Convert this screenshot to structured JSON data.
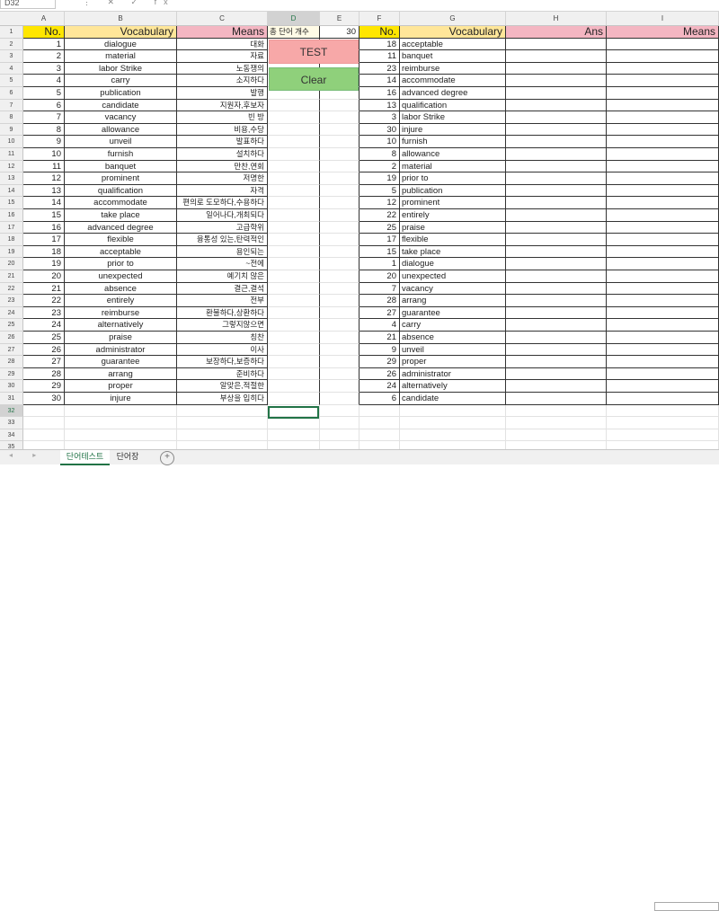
{
  "formula_bar": {
    "name_box": "D32",
    "icons": "⋮ ✕ ✓ fx"
  },
  "columns": [
    "A",
    "B",
    "C",
    "D",
    "E",
    "F",
    "G",
    "H",
    "I"
  ],
  "selected_column": "D",
  "headers": {
    "no": "No.",
    "vocab": "Vocabulary",
    "means": "Means",
    "count_label": "총 단어 개수",
    "count_value": "30",
    "no2": "No.",
    "vocab2": "Vocabulary",
    "ans": "Ans",
    "means2": "Means"
  },
  "buttons": {
    "test": "TEST",
    "clear": "Clear"
  },
  "left_table": [
    [
      "1",
      "dialogue",
      "대화"
    ],
    [
      "2",
      "material",
      "자료"
    ],
    [
      "3",
      "labor Strike",
      "노동쟁의"
    ],
    [
      "4",
      "carry",
      "소지하다"
    ],
    [
      "5",
      "publication",
      "발행"
    ],
    [
      "6",
      "candidate",
      "지원자,후보자"
    ],
    [
      "7",
      "vacancy",
      "빈 방"
    ],
    [
      "8",
      "allowance",
      "비용,수당"
    ],
    [
      "9",
      "unveil",
      "발표하다"
    ],
    [
      "10",
      "furnish",
      "설치하다"
    ],
    [
      "11",
      "banquet",
      "만찬,연회"
    ],
    [
      "12",
      "prominent",
      "저명한"
    ],
    [
      "13",
      "qualification",
      "자격"
    ],
    [
      "14",
      "accommodate",
      "편의로 도모하다,수용하다"
    ],
    [
      "15",
      "take place",
      "일어나다,개최되다"
    ],
    [
      "16",
      "advanced degree",
      "고급학위"
    ],
    [
      "17",
      "flexible",
      "융통성 있는,탄력적인"
    ],
    [
      "18",
      "acceptable",
      "용인되는"
    ],
    [
      "19",
      "prior to",
      "~전에"
    ],
    [
      "20",
      "unexpected",
      "예기치 않은"
    ],
    [
      "21",
      "absence",
      "결근,결석"
    ],
    [
      "22",
      "entirely",
      "전부"
    ],
    [
      "23",
      "reimburse",
      "환불하다,상환하다"
    ],
    [
      "24",
      "alternatively",
      "그렇지않으면"
    ],
    [
      "25",
      "praise",
      "칭찬"
    ],
    [
      "26",
      "administrator",
      "이사"
    ],
    [
      "27",
      "guarantee",
      "보장하다,보증하다"
    ],
    [
      "28",
      "arrang",
      "준비하다"
    ],
    [
      "29",
      "proper",
      "알맞은,적절한"
    ],
    [
      "30",
      "injure",
      "부상을 입히다"
    ]
  ],
  "right_table": [
    [
      "18",
      "acceptable"
    ],
    [
      "11",
      "banquet"
    ],
    [
      "23",
      "reimburse"
    ],
    [
      "14",
      "accommodate"
    ],
    [
      "16",
      "advanced degree"
    ],
    [
      "13",
      "qualification"
    ],
    [
      "3",
      "labor Strike"
    ],
    [
      "30",
      "injure"
    ],
    [
      "10",
      "furnish"
    ],
    [
      "8",
      "allowance"
    ],
    [
      "2",
      "material"
    ],
    [
      "19",
      "prior to"
    ],
    [
      "5",
      "publication"
    ],
    [
      "12",
      "prominent"
    ],
    [
      "22",
      "entirely"
    ],
    [
      "25",
      "praise"
    ],
    [
      "17",
      "flexible"
    ],
    [
      "15",
      "take place"
    ],
    [
      "1",
      "dialogue"
    ],
    [
      "20",
      "unexpected"
    ],
    [
      "7",
      "vacancy"
    ],
    [
      "28",
      "arrang"
    ],
    [
      "27",
      "guarantee"
    ],
    [
      "4",
      "carry"
    ],
    [
      "21",
      "absence"
    ],
    [
      "9",
      "unveil"
    ],
    [
      "29",
      "proper"
    ],
    [
      "26",
      "administrator"
    ],
    [
      "24",
      "alternatively"
    ],
    [
      "6",
      "candidate"
    ]
  ],
  "row_numbers": [
    "1",
    "2",
    "3",
    "4",
    "5",
    "6",
    "7",
    "8",
    "9",
    "10",
    "11",
    "12",
    "13",
    "14",
    "15",
    "16",
    "17",
    "18",
    "19",
    "20",
    "21",
    "22",
    "23",
    "24",
    "25",
    "26",
    "27",
    "28",
    "29",
    "30",
    "31",
    "32",
    "33",
    "34",
    "35"
  ],
  "selected_row": "32",
  "sheet_tabs": {
    "tab1": "단어테스트",
    "tab2": "단어장",
    "add": "+"
  },
  "colors": {
    "no_header": "#ffe600",
    "vocab_header": "#ffe699",
    "means_header": "#f4b6c2",
    "test_button": "#f7a8a8",
    "clear_button": "#8fd07b",
    "accent": "#217346"
  }
}
